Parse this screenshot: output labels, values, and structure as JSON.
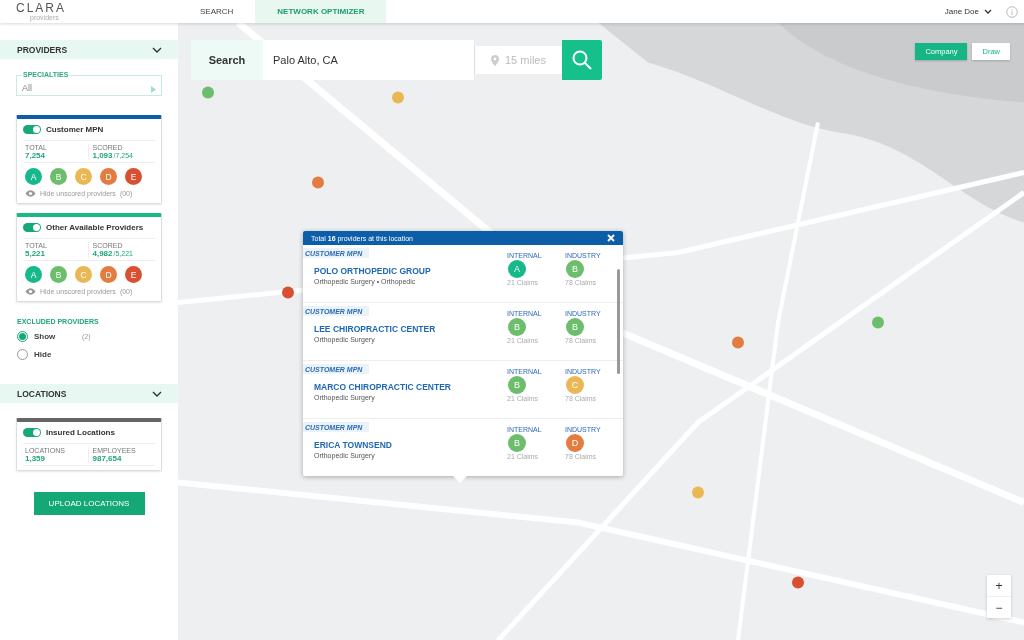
{
  "app": {
    "logo": "CLARA",
    "logo_sub": "providers"
  },
  "nav_tabs": [
    {
      "label": "SEARCH",
      "selected": false
    },
    {
      "label": "NETWORK OPTIMIZER",
      "selected": true
    }
  ],
  "user": {
    "name": "Jane Doe"
  },
  "sidebar": {
    "providers_section": {
      "title": "PROVIDERS",
      "expanded": true
    },
    "specialties": {
      "label": "SPECIALTIES",
      "value": "All"
    },
    "networks": [
      {
        "name": "Customer MPN",
        "on": true,
        "color": "#0d5ea8",
        "total_label": "TOTAL",
        "total": "7,254",
        "scored_label": "SCORED",
        "scored": "1,093",
        "scored_of": "/7,254",
        "hide_label": "Hide unscored providers",
        "hide_count": "(00)",
        "grades": [
          {
            "letter": "A",
            "color": "#17b98a"
          },
          {
            "letter": "B",
            "color": "#6cbd6c"
          },
          {
            "letter": "C",
            "color": "#e9b855"
          },
          {
            "letter": "D",
            "color": "#e27d3f"
          },
          {
            "letter": "E",
            "color": "#d8502f"
          }
        ]
      },
      {
        "name": "Other Available Providers",
        "on": true,
        "color": "#19b886",
        "total_label": "TOTAL",
        "total": "5,221",
        "scored_label": "SCORED",
        "scored": "4,982",
        "scored_of": "/5,221",
        "hide_label": "Hide unscored providers",
        "hide_count": "(00)",
        "grades": [
          {
            "letter": "A",
            "color": "#17b98a"
          },
          {
            "letter": "B",
            "color": "#6cbd6c"
          },
          {
            "letter": "C",
            "color": "#e9b855"
          },
          {
            "letter": "D",
            "color": "#e27d3f"
          },
          {
            "letter": "E",
            "color": "#d8502f"
          }
        ]
      }
    ],
    "excluded": {
      "title": "EXCLUDED PROVIDERS",
      "options": [
        {
          "label": "Show",
          "count": "(2)",
          "selected": true
        },
        {
          "label": "Hide",
          "selected": false
        }
      ]
    },
    "locations_section": {
      "title": "LOCATIONS",
      "expanded": true
    },
    "locations_card": {
      "name": "Insured Locations",
      "on": true,
      "stats": [
        {
          "label": "LOCATIONS",
          "value": "1,359"
        },
        {
          "label": "EMPLOYEES",
          "value": "987,654"
        }
      ]
    },
    "upload_button": "UPLOAD LOCATIONS"
  },
  "search": {
    "label": "Search",
    "value": "Palo Alto, CA",
    "radius": {
      "placeholder": "15 miles"
    }
  },
  "map_modes": [
    {
      "label": "Company",
      "selected": true
    },
    {
      "label": "Draw",
      "selected": false
    }
  ],
  "popup": {
    "title": "Total **16** providers at this location",
    "providers": [
      {
        "network": "CUSTOMER MPN",
        "name": "POLO ORTHOPEDIC GROUP",
        "specialty": "Orthopedic Surgery • Orthopedic",
        "internal": {
          "label": "INTERNAL",
          "grade": "A",
          "color": "#17b98a",
          "claims": "21 Claims"
        },
        "industry": {
          "label": "INDUSTRY",
          "grade": "B",
          "color": "#6cbd6c",
          "claims": "78 Claims"
        }
      },
      {
        "network": "CUSTOMER MPN",
        "name": "LEE CHIROPRACTIC CENTER",
        "specialty": "Orthopedic Surgery",
        "internal": {
          "label": "INTERNAL",
          "grade": "B",
          "color": "#6cbd6c",
          "claims": "21 Claims"
        },
        "industry": {
          "label": "INDUSTRY",
          "grade": "B",
          "color": "#6cbd6c",
          "claims": "78 Claims"
        }
      },
      {
        "network": "CUSTOMER MPN",
        "name": "MARCO CHIROPRACTIC CENTER",
        "specialty": "Orthopedic Surgery",
        "internal": {
          "label": "INTERNAL",
          "grade": "B",
          "color": "#6cbd6c",
          "claims": "21 Claims"
        },
        "industry": {
          "label": "INDUSTRY",
          "grade": "C",
          "color": "#e9b855",
          "claims": "78 Claims"
        }
      },
      {
        "network": "CUSTOMER MPN",
        "name": "ERICA TOWNSEND",
        "specialty": "Orthopedic Surgery",
        "internal": {
          "label": "INTERNAL",
          "grade": "B",
          "color": "#6cbd6c",
          "claims": "21 Claims"
        },
        "industry": {
          "label": "INDUSTRY",
          "grade": "D",
          "color": "#e27d3f",
          "claims": "78 Claims"
        }
      }
    ]
  },
  "zoom": {
    "in": "+",
    "out": "−"
  }
}
